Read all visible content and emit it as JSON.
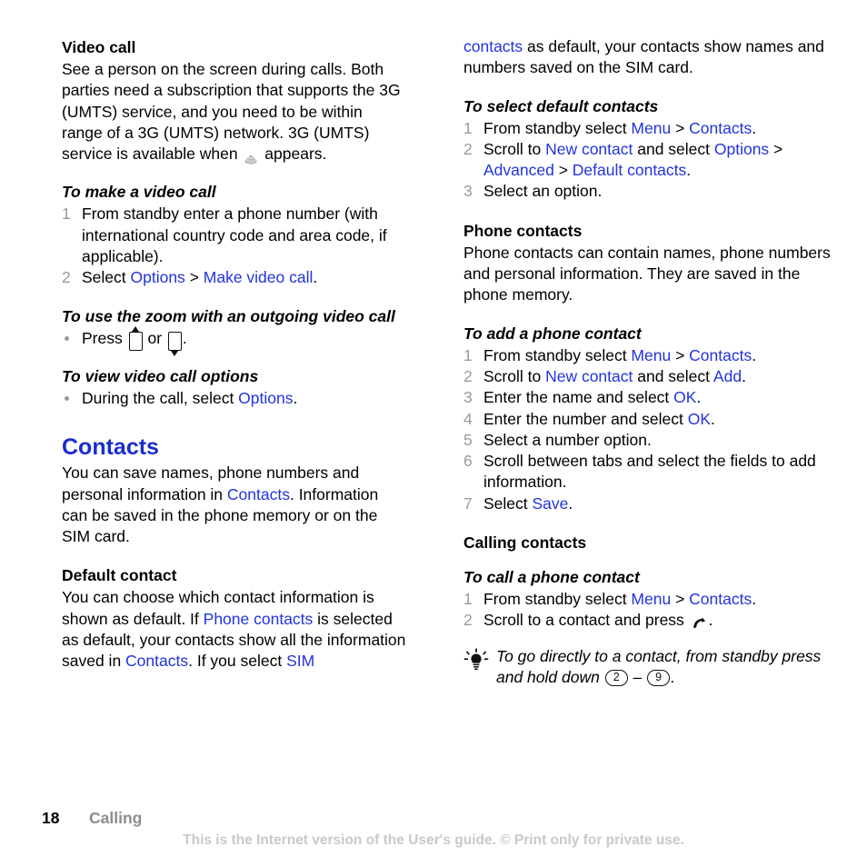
{
  "document": {
    "page_number": "18",
    "section": "Calling",
    "footer_notice": "This is the Internet version of the User's guide. © Print only for private use.",
    "accent_color": "#2233dd",
    "muted_color": "#9a9a9a"
  },
  "left_column": {
    "video_call": {
      "heading": "Video call",
      "body_1": "See a person on the screen during calls. Both parties need a subscription that supports the 3G (UMTS) service, and you need to be within range of a 3G (UMTS) network. 3G (UMTS) ",
      "body_2": "service is available when ",
      "body_3": " appears.",
      "icon_3g_name": "3g-umts-icon"
    },
    "make_video_call": {
      "heading": "To make a video call",
      "steps": [
        {
          "num": "1",
          "text": "From standby enter a phone number (with international country code and area code, if applicable)."
        },
        {
          "num": "2",
          "prefix": "Select ",
          "link_1": "Options",
          "sep": " > ",
          "link_2": "Make video call",
          "suffix": "."
        }
      ]
    },
    "zoom_outgoing": {
      "heading": "To use the zoom with an outgoing video call",
      "bullet_prefix": "Press ",
      "bullet_middle": " or ",
      "bullet_suffix": ".",
      "key_up_name": "navigation-key-up-icon",
      "key_down_name": "navigation-key-down-icon"
    },
    "view_video_call_options": {
      "heading": "To view video call options",
      "bullet_prefix": "During the call, select ",
      "bullet_link": "Options",
      "bullet_suffix": "."
    },
    "contacts": {
      "heading": "Contacts",
      "body_1": "You can save names, phone numbers and personal information in ",
      "link_1": "Contacts",
      "body_2": ". Information can be saved in the phone memory or on the SIM card."
    },
    "default_contact": {
      "heading": "Default contact",
      "body_1": "You can choose which contact information is shown as default. If ",
      "link_1": "Phone contacts",
      "body_2": " is selected as default, your contacts show all the information saved in ",
      "link_2": "Contacts",
      "body_3": ". If you select ",
      "link_3": "SIM"
    }
  },
  "right_column": {
    "default_contact_cont": {
      "link_1": "contacts",
      "body_1": " as default, your contacts show names and numbers saved on the SIM card."
    },
    "select_default_contacts": {
      "heading": "To select default contacts",
      "steps": [
        {
          "num": "1",
          "prefix": "From standby select ",
          "link_1": "Menu",
          "sep": " > ",
          "link_2": "Contacts",
          "suffix": "."
        },
        {
          "num": "2",
          "prefix": "Scroll to ",
          "link_1": "New contact",
          "mid": " and select ",
          "link_2": "Options",
          "sep_1": " > ",
          "link_3": "Advanced",
          "sep_2": " > ",
          "link_4": "Default contacts",
          "suffix": "."
        },
        {
          "num": "3",
          "text": "Select an option."
        }
      ]
    },
    "phone_contacts": {
      "heading": "Phone contacts",
      "body": "Phone contacts can contain names, phone numbers and personal information. They are saved in the phone memory."
    },
    "add_phone_contact": {
      "heading": "To add a phone contact",
      "steps": [
        {
          "num": "1",
          "prefix": "From standby select ",
          "link_1": "Menu",
          "sep": " > ",
          "link_2": "Contacts",
          "suffix": "."
        },
        {
          "num": "2",
          "prefix": "Scroll to ",
          "link_1": "New contact",
          "mid": " and select ",
          "link_2": "Add",
          "suffix": "."
        },
        {
          "num": "3",
          "prefix": "Enter the name and select ",
          "link_1": "OK",
          "suffix": "."
        },
        {
          "num": "4",
          "prefix": "Enter the number and select ",
          "link_1": "OK",
          "suffix": "."
        },
        {
          "num": "5",
          "text": "Select a number option."
        },
        {
          "num": "6",
          "text": "Scroll between tabs and select the fields to add information."
        },
        {
          "num": "7",
          "prefix": "Select ",
          "link_1": "Save",
          "suffix": "."
        }
      ]
    },
    "calling_contacts": {
      "heading": "Calling contacts"
    },
    "call_phone_contact": {
      "heading": "To call a phone contact",
      "steps": [
        {
          "num": "1",
          "prefix": "From standby select ",
          "link_1": "Menu",
          "sep": " > ",
          "link_2": "Contacts",
          "suffix": "."
        },
        {
          "num": "2",
          "prefix": "Scroll to a contact and press ",
          "suffix": ".",
          "icon_name": "call-handset-icon"
        }
      ]
    },
    "tip": {
      "icon_name": "lightbulb-tip-icon",
      "text_1": "To go directly to a contact, from standby press and hold down ",
      "key_1": "2",
      "dash": " – ",
      "key_2": "9",
      "text_2": "."
    }
  }
}
